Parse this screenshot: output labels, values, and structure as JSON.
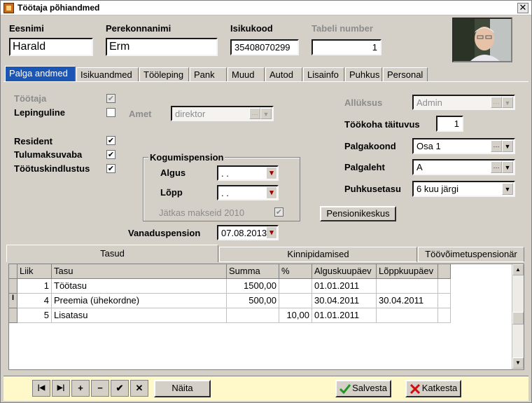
{
  "window": {
    "title": "Töötaja põhiandmed",
    "close_glyph": "✕"
  },
  "header": {
    "first_name_label": "Eesnimi",
    "first_name_value": "Harald",
    "last_name_label": "Perekonnanimi",
    "last_name_value": "Erm",
    "id_code_label": "Isikukood",
    "id_code_value": "35408070299",
    "tabel_label": "Tabeli number",
    "tabel_value": "1"
  },
  "tabs": [
    "Palga andmed",
    "Isikuandmed",
    "Tööleping",
    "Pank",
    "Muud",
    "Autod",
    "Lisainfo",
    "Puhkus",
    "Personal"
  ],
  "form": {
    "tootaja_label": "Töötaja",
    "tootaja_checked": true,
    "lepinguline_label": "Lepinguline",
    "lepinguline_checked": false,
    "amet_label": "Amet",
    "amet_value": "direktor",
    "resident_label": "Resident",
    "resident_checked": true,
    "tulumaksuvaba_label": "Tulumaksuvaba",
    "tulumaksuvaba_checked": true,
    "tootuskindlustus_label": "Töötuskindlustus",
    "tootuskindlustus_checked": true,
    "kogumispension_title": "Kogumispension",
    "algus_label": "Algus",
    "algus_value": " . .",
    "lopp_label": "Lõpp",
    "lopp_value": " . .",
    "jatkas_label": "Jätkas makseid 2010",
    "jatkas_checked": true,
    "vanaduspension_label": "Vanaduspension",
    "vanaduspension_value": "07.08.2013",
    "alluksus_label": "Allüksus",
    "alluksus_value": "Admin",
    "tookoha_label": "Töökoha täituvus",
    "tookoha_value": "1",
    "palgakoond_label": "Palgakoond",
    "palgakoond_value": "Osa 1",
    "palgaleht_label": "Palgaleht",
    "palgaleht_value": "A",
    "puhkusetasu_label": "Puhkusetasu",
    "puhkusetasu_value": "6 kuu järgi",
    "pensionikeskus_label": "Pensionikeskus",
    "dots_glyph": "···",
    "dropdown_glyph": "▼",
    "check_glyph": "✔"
  },
  "subtabs": [
    "Tasud",
    "Kinnipidamised",
    "Töövõimetuspensionär"
  ],
  "grid": {
    "columns": [
      "Liik",
      "Tasu",
      "Summa",
      "%",
      "Alguskuupäev",
      "Lõppkuupäev"
    ],
    "rows": [
      {
        "indicator": "",
        "liik": "1",
        "tasu": "Töötasu",
        "summa": "1500,00",
        "pct": "",
        "algus": "01.01.2011",
        "lopp": ""
      },
      {
        "indicator": "I",
        "liik": "4",
        "tasu": "Preemia (ühekordne)",
        "summa": "500,00",
        "pct": "",
        "algus": "30.04.2011",
        "lopp": "30.04.2011"
      },
      {
        "indicator": "",
        "liik": "5",
        "tasu": "Lisatasu",
        "summa": "",
        "pct": "10,00",
        "algus": "01.01.2011",
        "lopp": ""
      }
    ]
  },
  "bottom": {
    "nav_first": "|◀",
    "nav_last": "▶|",
    "nav_add": "+",
    "nav_remove": "−",
    "nav_confirm": "✔",
    "nav_cancel": "✕",
    "naita_label": "Näita",
    "salvesta_label": "Salvesta",
    "katkesta_label": "Katkesta"
  },
  "colors": {
    "active_tab": "#1b56b4",
    "bottom_bar": "#fff8c8",
    "salvesta_icon": "#1e9a1e",
    "katkesta_icon": "#d01010"
  }
}
